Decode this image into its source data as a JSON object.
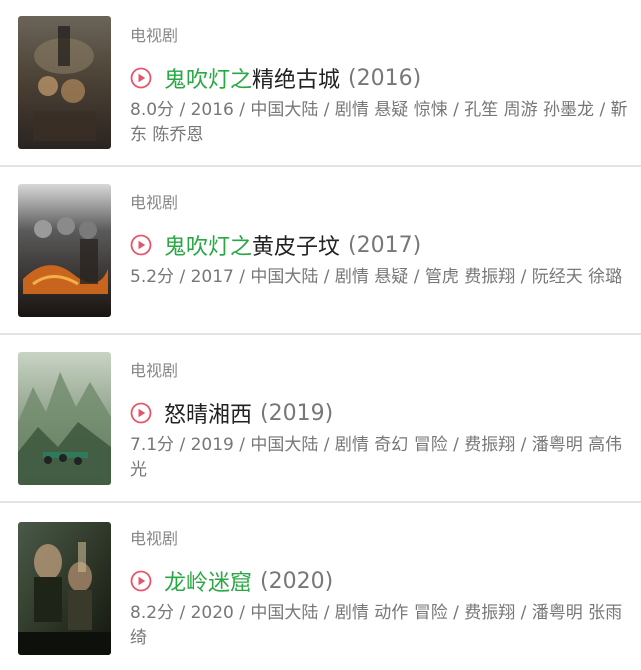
{
  "items": [
    {
      "category": "电视剧",
      "title_highlight": "鬼吹灯之",
      "title_rest": "精绝古城",
      "year": "(2016)",
      "meta": "8.0分 / 2016 / 中国大陆 / 剧情 悬疑 惊悚 / 孔笙 周游 孙墨龙 / 靳东 陈乔恩"
    },
    {
      "category": "电视剧",
      "title_highlight": "鬼吹灯之",
      "title_rest": "黄皮子坟",
      "year": "(2017)",
      "meta": "5.2分 / 2017 / 中国大陆 / 剧情 悬疑 / 管虎 费振翔 / 阮经天 徐璐"
    },
    {
      "category": "电视剧",
      "title_highlight": "",
      "title_rest": "怒晴湘西",
      "year": "(2019)",
      "meta": "7.1分 / 2019 / 中国大陆 / 剧情 奇幻 冒险 / 费振翔 / 潘粤明 高伟光"
    },
    {
      "category": "电视剧",
      "title_highlight": "龙岭迷窟",
      "title_rest": "",
      "year": "(2020)",
      "meta": "8.2分 / 2020 / 中国大陆 / 剧情 动作 冒险 / 费振翔 / 潘粤明 张雨绮"
    }
  ],
  "colors": {
    "highlight": "#2aa845",
    "play_icon": "#e8546a"
  },
  "icons": {
    "play": "play-circle-icon"
  }
}
